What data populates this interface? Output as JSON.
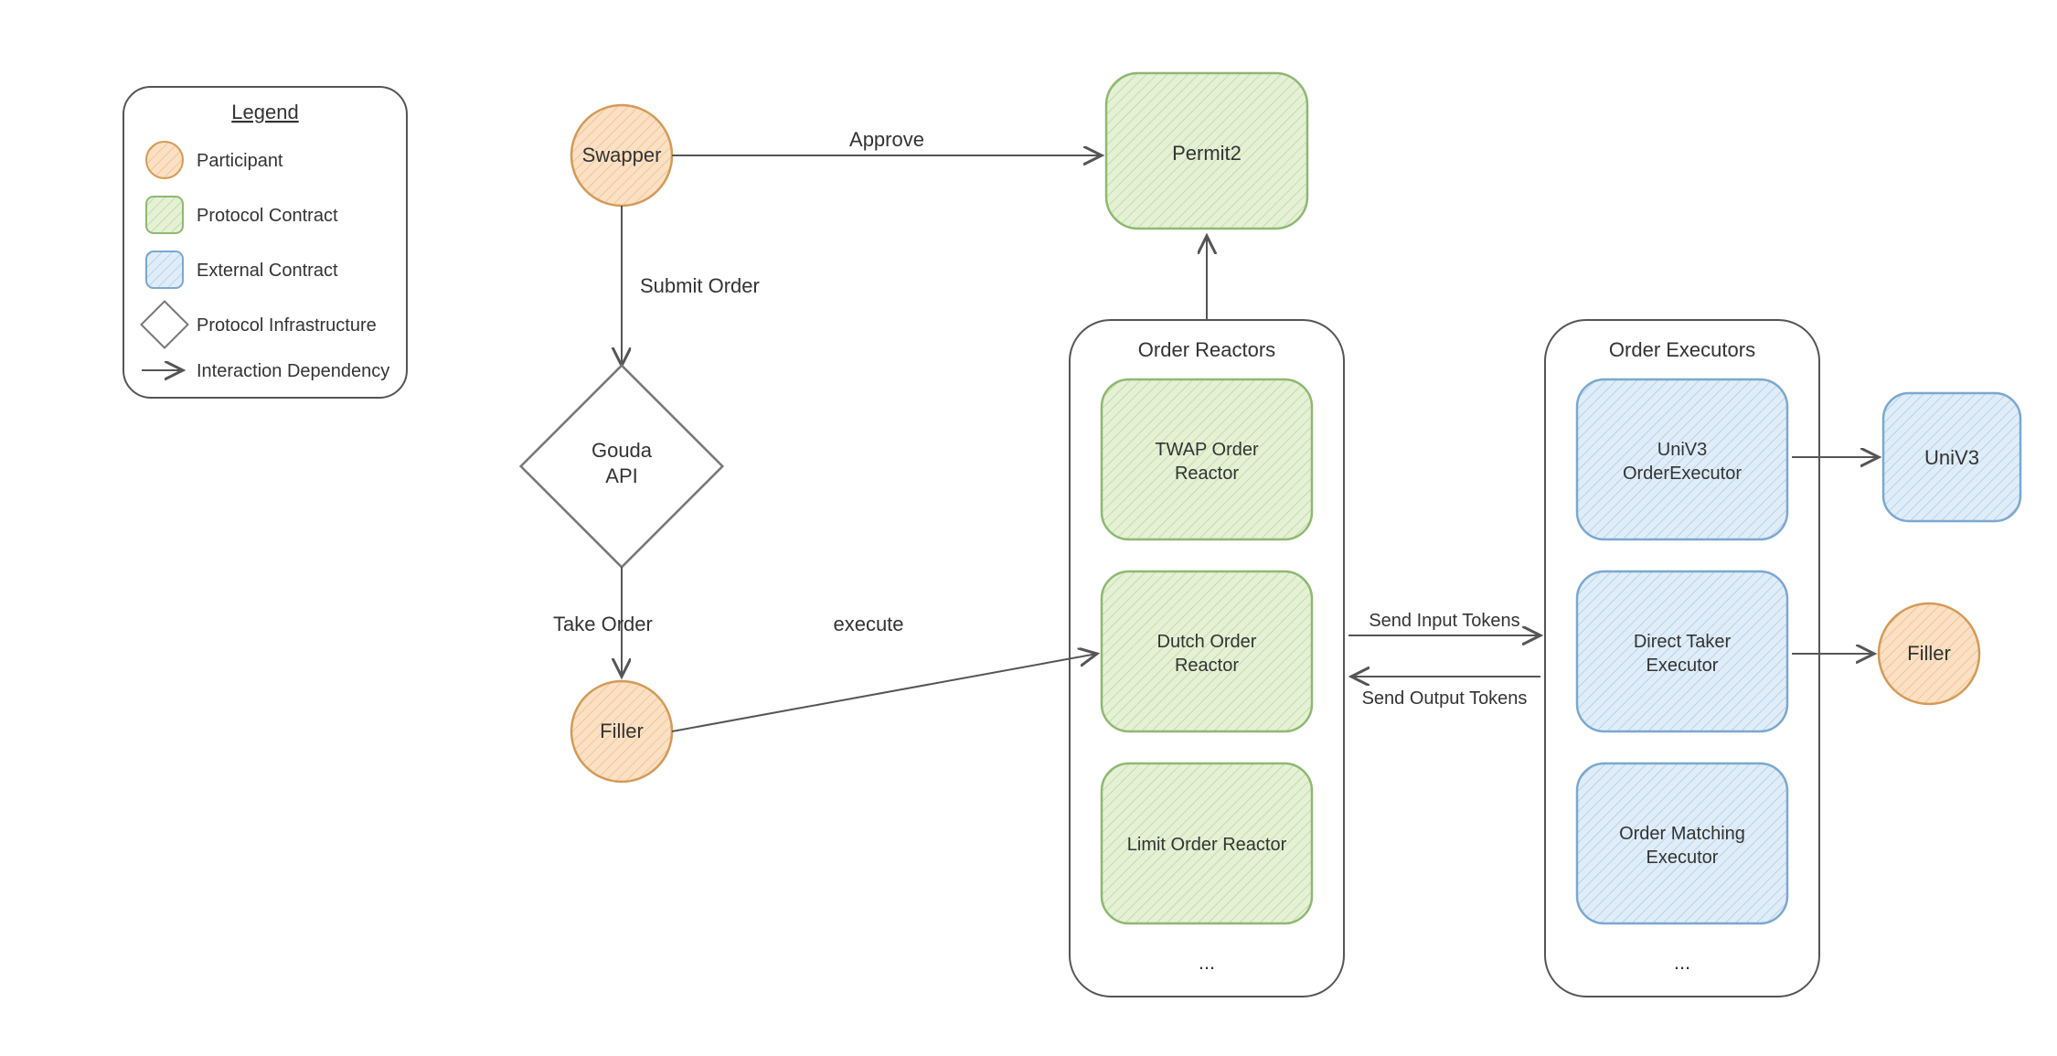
{
  "legend": {
    "title": "Legend",
    "participant": "Participant",
    "protocol_contract": "Protocol Contract",
    "external_contract": "External Contract",
    "protocol_infrastructure": "Protocol Infrastructure",
    "interaction_dependency": "Interaction Dependency"
  },
  "nodes": {
    "swapper": "Swapper",
    "permit2": "Permit2",
    "gouda_api_line1": "Gouda",
    "gouda_api_line2": "API",
    "filler": "Filler",
    "filler2": "Filler",
    "univ3": "UniV3"
  },
  "groups": {
    "order_reactors": {
      "title": "Order Reactors",
      "items": {
        "twap_line1": "TWAP Order",
        "twap_line2": "Reactor",
        "dutch_line1": "Dutch Order",
        "dutch_line2": "Reactor",
        "limit": "Limit Order Reactor"
      },
      "ellipsis": "..."
    },
    "order_executors": {
      "title": "Order Executors",
      "items": {
        "univ3_line1": "UniV3",
        "univ3_line2": "OrderExecutor",
        "direct_line1": "Direct Taker",
        "direct_line2": "Executor",
        "matching_line1": "Order Matching",
        "matching_line2": "Executor"
      },
      "ellipsis": "..."
    }
  },
  "edges": {
    "approve": "Approve",
    "submit_order": "Submit Order",
    "take_order": "Take Order",
    "execute": "execute",
    "send_input": "Send Input Tokens",
    "send_output": "Send Output Tokens"
  },
  "colors": {
    "participant_fill": "#fbe0c3",
    "participant_stroke": "#d49a56",
    "protocol_fill": "#d9ecc7",
    "protocol_stroke": "#8fb872",
    "external_fill": "#cfe3f5",
    "external_stroke": "#7ba8d0",
    "infra_fill": "#ffffff",
    "infra_stroke": "#777777",
    "arrow": "#555555"
  }
}
